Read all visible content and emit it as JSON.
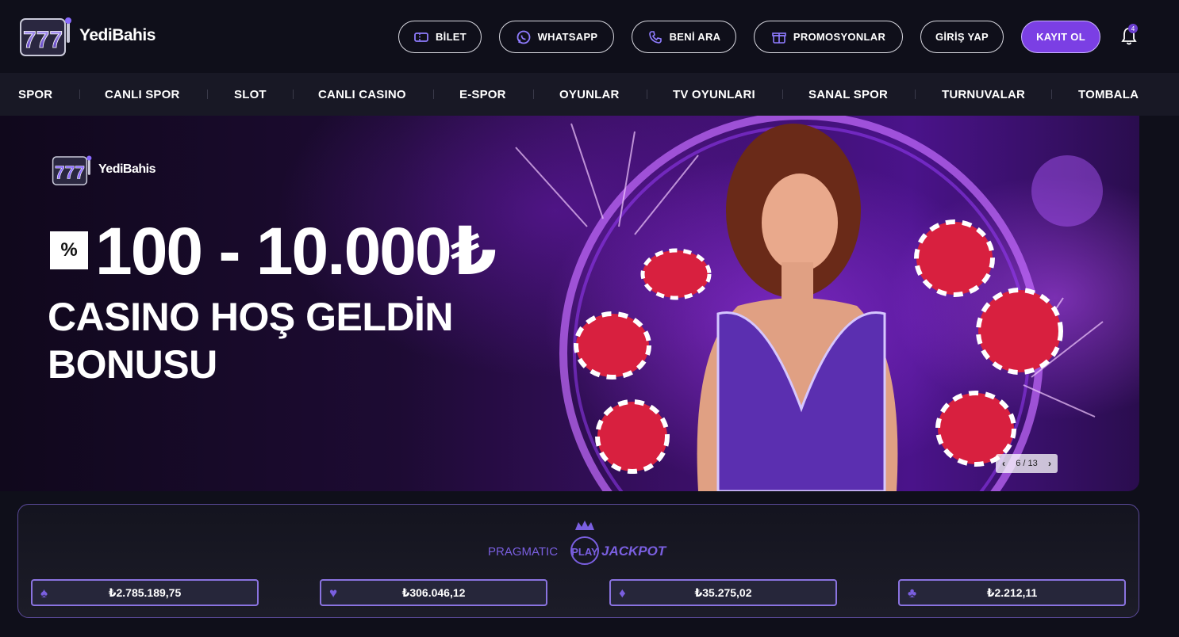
{
  "brand": {
    "name": "YediBahis"
  },
  "header": {
    "buttons": [
      {
        "label": "BİLET",
        "icon": "ticket-icon"
      },
      {
        "label": "WHATSAPP",
        "icon": "whatsapp-icon"
      },
      {
        "label": "BENİ ARA",
        "icon": "phone-icon"
      },
      {
        "label": "PROMOSYONLAR",
        "icon": "gift-icon"
      },
      {
        "label": "GİRİŞ YAP"
      },
      {
        "label": "KAYIT OL"
      }
    ],
    "notifications": {
      "icon": "bell-icon",
      "count": "4"
    }
  },
  "nav": {
    "items": [
      "SPOR",
      "CANLI SPOR",
      "SLOT",
      "CANLI CASINO",
      "E-SPOR",
      "OYUNLAR",
      "TV OYUNLARI",
      "SANAL SPOR",
      "TURNUVALAR",
      "TOMBALA"
    ]
  },
  "hero": {
    "percent_symbol": "%",
    "amount": "100 - 10.000₺",
    "line1": "CASINO HOŞ GELDİN",
    "line2": "BONUSU",
    "slider": {
      "current": "6",
      "total": "13",
      "text": "6 / 13"
    }
  },
  "jackpot": {
    "brand_text_left": "PRAGMATIC",
    "brand_text_mid": "PLAY",
    "brand_text_right": "JACKPOT",
    "tiers": [
      {
        "suit": "spade-icon",
        "glyph": "♠",
        "value": "₺2.785.189,75"
      },
      {
        "suit": "heart-icon",
        "glyph": "♥",
        "value": "₺306.046,12"
      },
      {
        "suit": "diamond-icon",
        "glyph": "♦",
        "value": "₺35.275,02"
      },
      {
        "suit": "club-icon",
        "glyph": "♣",
        "value": "₺2.212,11"
      }
    ]
  },
  "colors": {
    "accent": "#7b3fe4",
    "background": "#0f0f1a",
    "nav_bg": "#181825",
    "jackpot_border": "#8a73e0"
  }
}
